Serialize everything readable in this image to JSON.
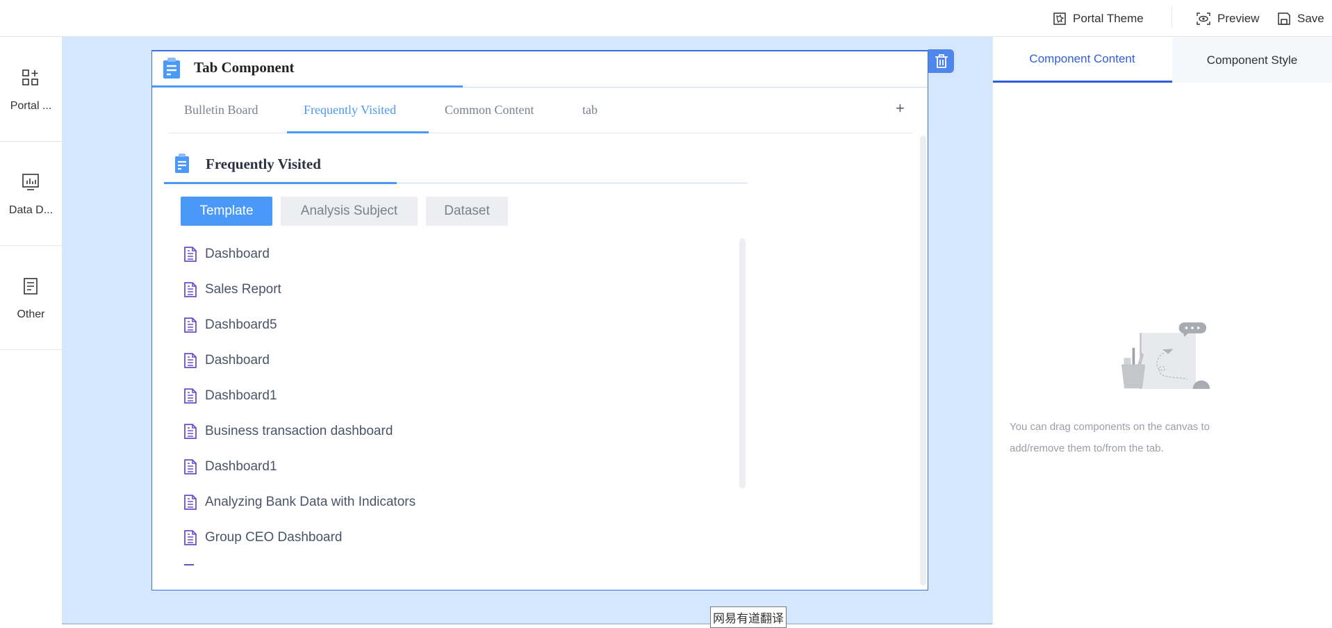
{
  "topbar": {
    "portal_theme": "Portal Theme",
    "preview": "Preview",
    "save": "Save"
  },
  "sidebar": {
    "items": [
      {
        "label": "Portal ..."
      },
      {
        "label": "Data D..."
      },
      {
        "label": "Other"
      }
    ]
  },
  "component": {
    "title": "Tab Component",
    "tabs": [
      {
        "label": "Bulletin Board"
      },
      {
        "label": "Frequently Visited"
      },
      {
        "label": "Common Content"
      },
      {
        "label": "tab"
      }
    ],
    "active_tab": "Frequently Visited",
    "add_tab": "+",
    "section_title": "Frequently Visited",
    "filters": [
      {
        "label": "Template"
      },
      {
        "label": "Analysis Subject"
      },
      {
        "label": "Dataset"
      }
    ],
    "items": [
      "Dashboard",
      "Sales Report",
      "Dashboard5",
      "Dashboard",
      "Dashboard1",
      "Business transaction dashboard",
      "Dashboard1",
      "Analyzing Bank Data with Indicators",
      "Group CEO Dashboard"
    ]
  },
  "right_panel": {
    "tabs": [
      {
        "label": "Component Content"
      },
      {
        "label": "Component Style"
      }
    ],
    "hint_line1": "You can drag components on the canvas to",
    "hint_line2": "add/remove them to/from the tab."
  },
  "tooltip": "网易有道翻译",
  "colors": {
    "accent": "#4a98f7",
    "canvas": "#d4e7fc",
    "border": "#3a6fe0",
    "doc_icon": "#6a4fc9"
  }
}
